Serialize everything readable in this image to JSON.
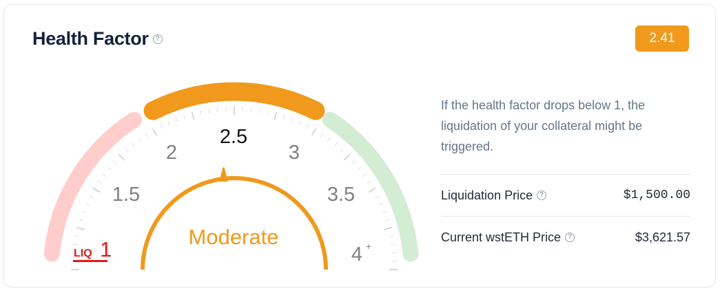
{
  "header": {
    "title": "Health Factor",
    "help_icon": "question-circle-icon",
    "value_badge": "2.41"
  },
  "gauge": {
    "current_value": 2.41,
    "status_label": "Moderate",
    "liq_label": "LIQ",
    "liq_value": "1",
    "tick_labels": [
      "1.5",
      "2",
      "2.5",
      "3",
      "3.5",
      "4"
    ],
    "max_suffix": "+",
    "colors": {
      "danger": "#ffcdcb",
      "moderate": "#f0991c",
      "safe": "#d3edd4",
      "liq": "#e0191b",
      "ticks": "#d6d6d6",
      "labels": "#808080"
    }
  },
  "info": {
    "description": "If the health factor drops below 1, the liquidation of your collateral might be triggered.",
    "rows": [
      {
        "label": "Liquidation Price",
        "value": "$1,500.00"
      },
      {
        "label": "Current wstETH Price",
        "value": "$3,621.57"
      }
    ]
  }
}
